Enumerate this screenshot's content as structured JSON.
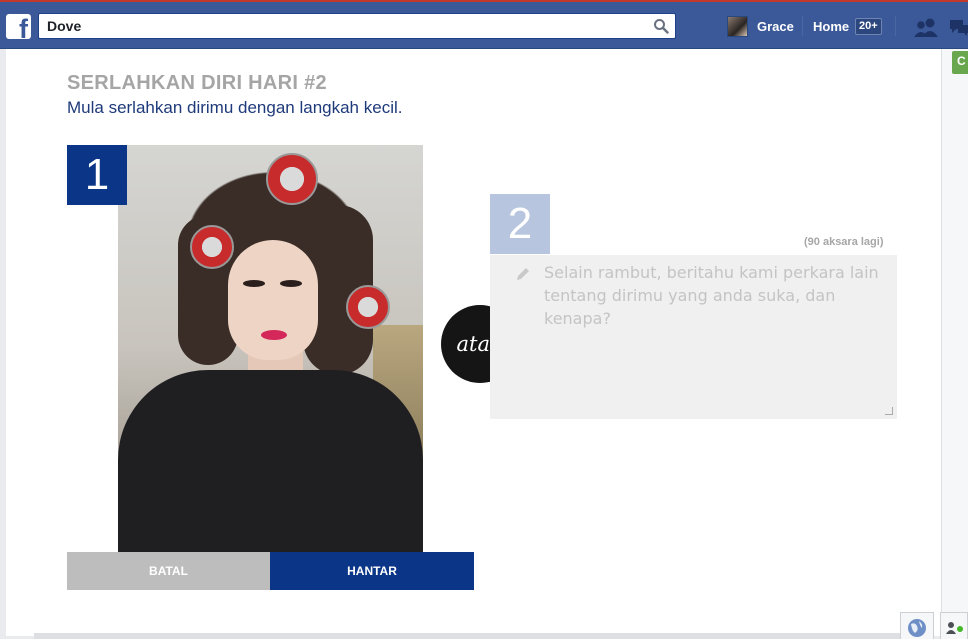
{
  "topbar": {
    "search_value": "Dove",
    "user_name": "Grace",
    "home_label": "Home",
    "home_badge": "20+"
  },
  "page": {
    "title": "SERLAHKAN DIRI HARI #2",
    "subtitle": "Mula serlahkan dirimu dengan langkah kecil."
  },
  "step1": {
    "number": "1"
  },
  "step2": {
    "number": "2",
    "char_count": "(90 aksara lagi)",
    "placeholder": "Selain rambut, beritahu kami perkara lain tentang dirimu yang anda suka, dan kenapa?"
  },
  "divider": {
    "label": "atau"
  },
  "buttons": {
    "cancel": "BATAL",
    "submit": "HANTAR"
  },
  "side": {
    "green_label": "C"
  },
  "colors": {
    "facebook_blue": "#3b5998",
    "dove_navy": "#0b3587",
    "step2_light": "#b7c6de",
    "cancel_grey": "#bdbdbd"
  }
}
